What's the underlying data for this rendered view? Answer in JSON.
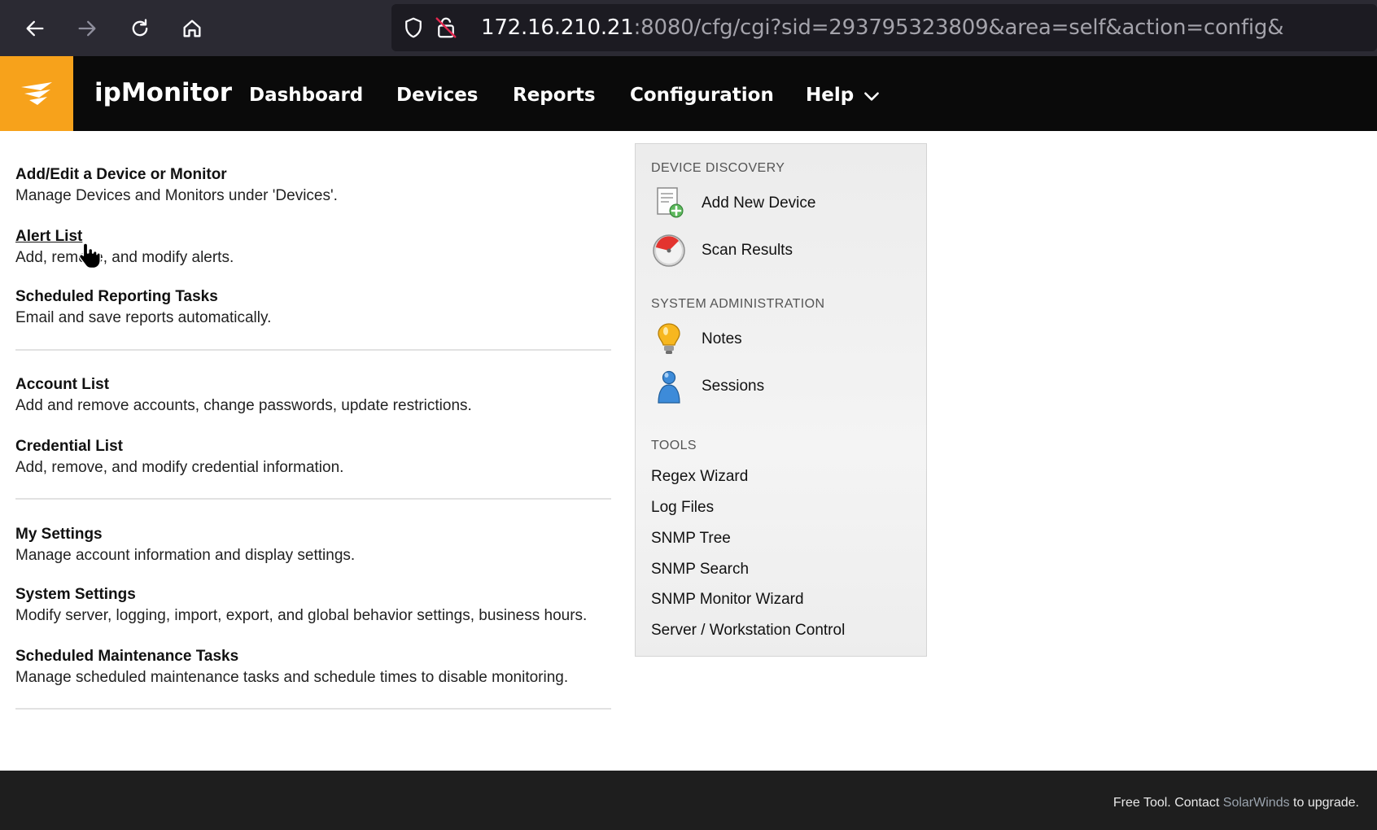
{
  "browser": {
    "url_host": "172.16.210.21",
    "url_rest": ":8080/cfg/cgi?sid=293795323809&area=self&action=config&",
    "icons": [
      "back-arrow-icon",
      "forward-arrow-icon",
      "reload-icon",
      "home-icon",
      "shield-icon",
      "insecure-lock-icon"
    ]
  },
  "header": {
    "app_name": "ipMonitor",
    "logo_color": "#f7a21b",
    "nav": [
      "Dashboard",
      "Devices",
      "Reports",
      "Configuration",
      "Help"
    ]
  },
  "config": {
    "items": [
      {
        "title": "Add/Edit a Device or Monitor",
        "desc": "Manage Devices and Monitors under 'Devices'."
      },
      {
        "title": "Alert List",
        "desc": "Add, remove, and modify alerts."
      },
      {
        "title": "Scheduled Reporting Tasks",
        "desc": "Email and save reports automatically."
      },
      {
        "title": "Account List",
        "desc": "Add and remove accounts, change passwords, update restrictions."
      },
      {
        "title": "Credential List",
        "desc": "Add, remove, and modify credential information."
      },
      {
        "title": "My Settings",
        "desc": "Manage account information and display settings."
      },
      {
        "title": "System Settings",
        "desc": "Modify server, logging, import, export, and global behavior settings, business hours."
      },
      {
        "title": "Scheduled Maintenance Tasks",
        "desc": "Manage scheduled maintenance tasks and schedule times to disable monitoring."
      }
    ]
  },
  "panel": {
    "device_discovery": {
      "heading": "DEVICE DISCOVERY",
      "links": [
        {
          "label": "Add New Device",
          "icon": "add-device-icon"
        },
        {
          "label": "Scan Results",
          "icon": "scan-results-icon"
        }
      ]
    },
    "system_admin": {
      "heading": "SYSTEM ADMINISTRATION",
      "links": [
        {
          "label": "Notes",
          "icon": "lightbulb-icon"
        },
        {
          "label": "Sessions",
          "icon": "user-icon"
        }
      ]
    },
    "tools": {
      "heading": "TOOLS",
      "links": [
        "Regex Wizard",
        "Log Files",
        "SNMP Tree",
        "SNMP Search",
        "SNMP Monitor Wizard",
        "Server / Workstation Control"
      ]
    }
  },
  "footer": {
    "prefix": "Free Tool. Contact ",
    "brand": "SolarWinds",
    "suffix": " to upgrade."
  }
}
